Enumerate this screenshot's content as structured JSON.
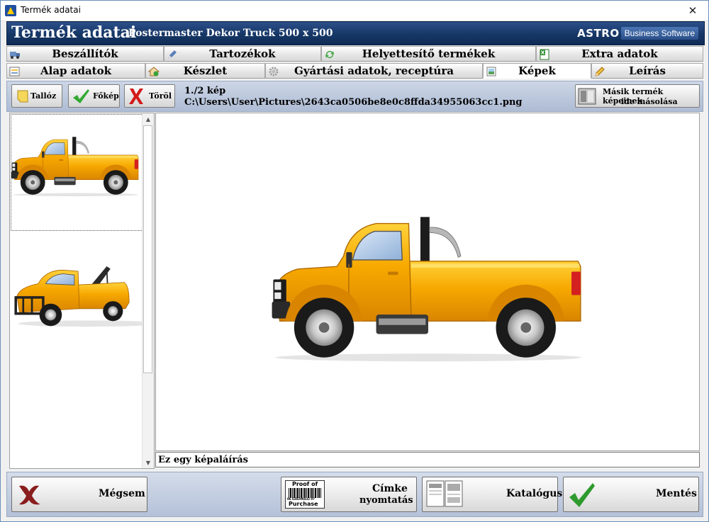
{
  "window": {
    "title": "Termék adatai",
    "close_glyph": "✕"
  },
  "header": {
    "title": "Termék adatai",
    "product": "Postermaster Dekor Truck  500 x 500",
    "brand": "ASTRO",
    "brand_sub": "Business Software"
  },
  "tabs_row1": [
    {
      "label": "Beszállítók",
      "icon": "truck-icon"
    },
    {
      "label": "Tartozékok",
      "icon": "pen-icon"
    },
    {
      "label": "Helyettesítő termékek",
      "icon": "refresh-icon"
    },
    {
      "label": "Extra adatok",
      "icon": "spreadsheet-icon"
    }
  ],
  "tabs_row2": [
    {
      "label": "Alap adatok",
      "icon": "form-icon"
    },
    {
      "label": "Készlet",
      "icon": "house-icon"
    },
    {
      "label": "Gyártási adatok, receptúra",
      "icon": "gear-icon"
    },
    {
      "label": "Képek",
      "icon": "image-icon",
      "active": true
    },
    {
      "label": "Leírás",
      "icon": "pencil-icon"
    }
  ],
  "toolbar": {
    "browse_label": "Tallóz",
    "main_image_label": "Főkép",
    "delete_label": "Töröl",
    "image_counter": "1./2 kép",
    "image_path": "C:\\Users\\User\\Pictures\\2643ca0506be8e0c8ffda34955063cc1.png",
    "copy_label_line1": "Másik termék képeinek",
    "copy_label_line2": "ide másolása"
  },
  "thumbnails": [
    {
      "name": "pickup-truck-thumbnail",
      "selected": true
    },
    {
      "name": "tow-truck-thumbnail",
      "selected": false
    }
  ],
  "caption": {
    "value": "Ez egy képaláírás"
  },
  "bottom": {
    "cancel_label": "Mégsem",
    "label_print_line1": "Címke",
    "label_print_line2": "nyomtatás",
    "proof_line1": "Proof of",
    "proof_line2": "Purchase",
    "barcode_digits": "96 638299432 97",
    "catalog_label": "Katalógus",
    "save_label": "Mentés"
  },
  "colors": {
    "header_bg": "#163766",
    "truck_body": "#f5a400",
    "accent_check": "#2e9a2e",
    "accent_delete": "#d41a1a"
  }
}
